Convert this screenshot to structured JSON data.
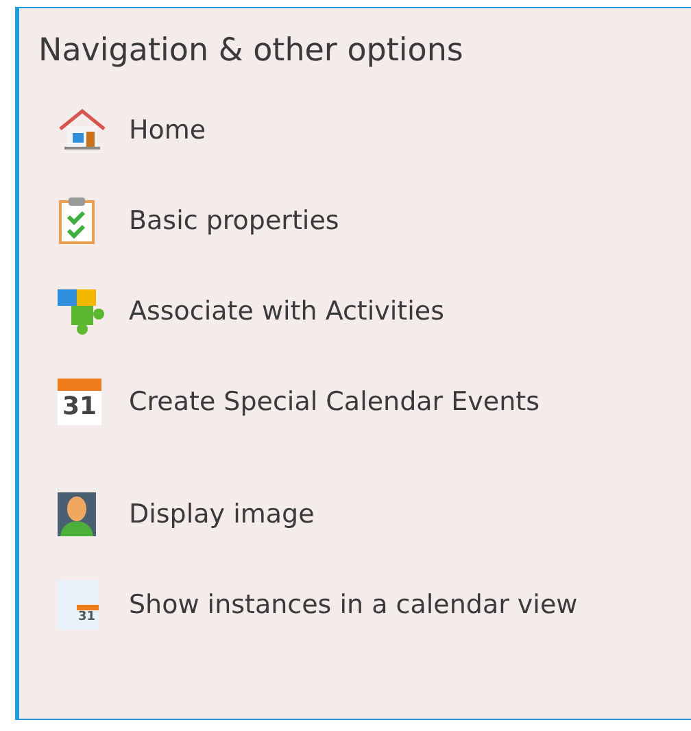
{
  "panel": {
    "title": "Navigation & other options"
  },
  "items": [
    {
      "kind": "home",
      "label": "Home"
    },
    {
      "kind": "clipboard",
      "label": "Basic properties"
    },
    {
      "kind": "puzzle",
      "label": "Associate with Activities"
    },
    {
      "kind": "calendar",
      "label": "Create Special Calendar Events",
      "icon_text": "31"
    },
    {
      "kind": "image",
      "label": "Display image"
    },
    {
      "kind": "calendar-file",
      "label": "Show instances in a calendar view",
      "icon_text": "31"
    }
  ]
}
